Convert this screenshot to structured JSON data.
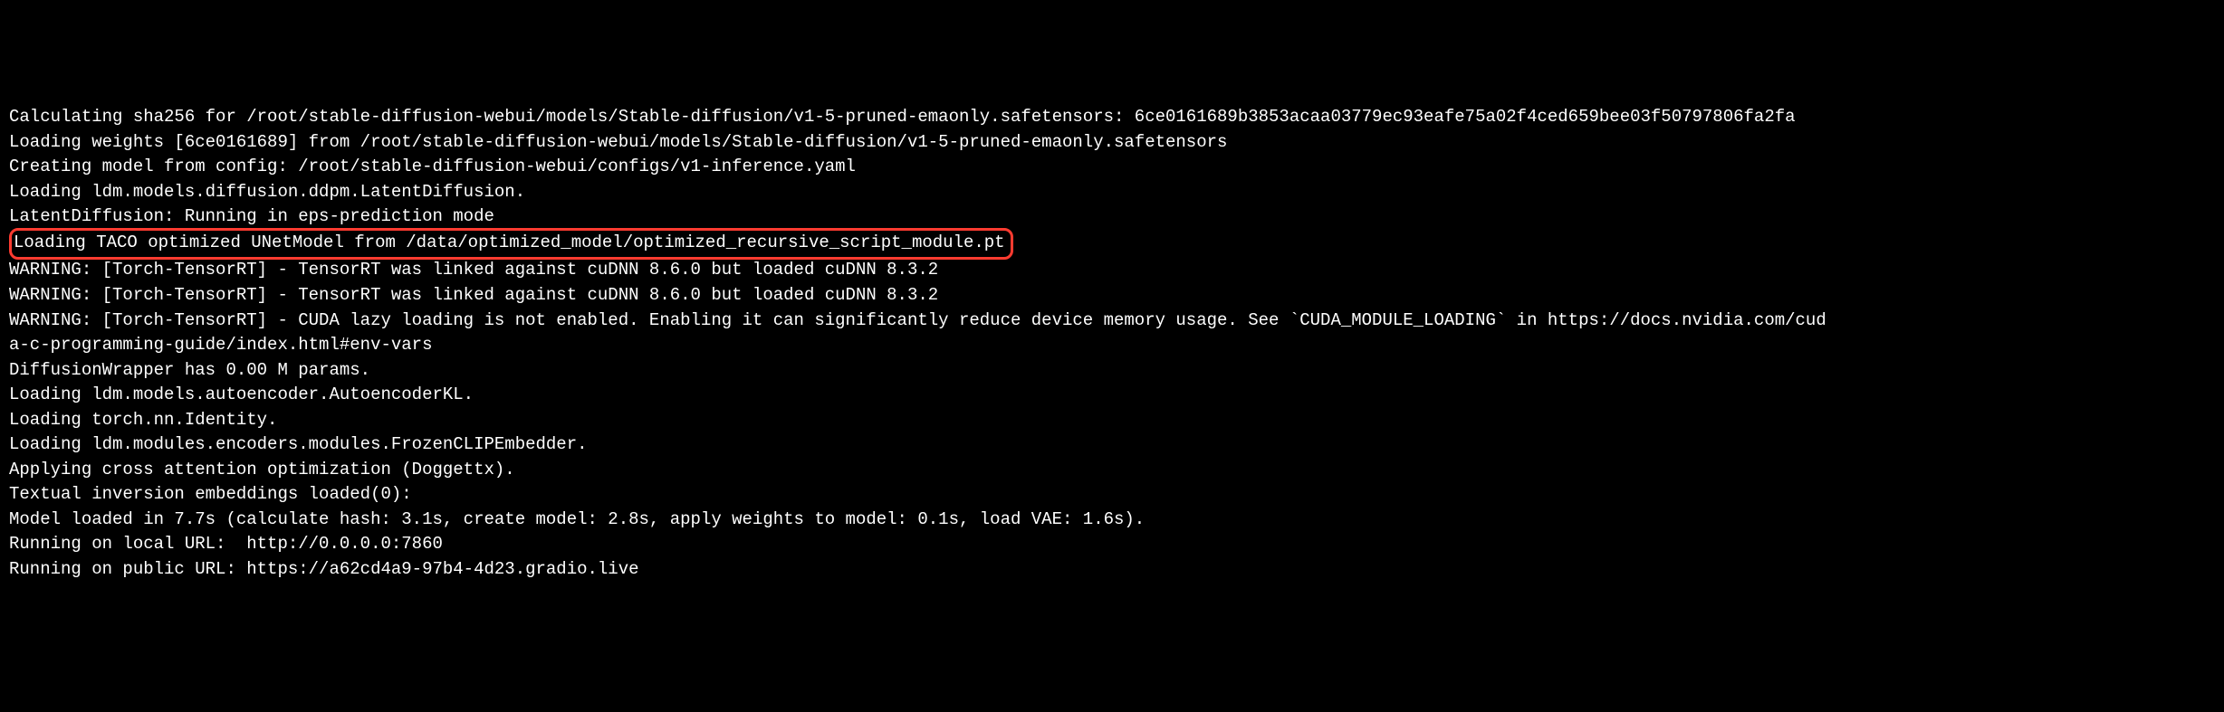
{
  "terminal": {
    "lines": [
      "Calculating sha256 for /root/stable-diffusion-webui/models/Stable-diffusion/v1-5-pruned-emaonly.safetensors: 6ce0161689b3853acaa03779ec93eafe75a02f4ced659bee03f50797806fa2fa",
      "Loading weights [6ce0161689] from /root/stable-diffusion-webui/models/Stable-diffusion/v1-5-pruned-emaonly.safetensors",
      "Creating model from config: /root/stable-diffusion-webui/configs/v1-inference.yaml",
      "Loading ldm.models.diffusion.ddpm.LatentDiffusion.",
      "LatentDiffusion: Running in eps-prediction mode",
      "Loading TACO optimized UNetModel from /data/optimized_model/optimized_recursive_script_module.pt",
      "WARNING: [Torch-TensorRT] - TensorRT was linked against cuDNN 8.6.0 but loaded cuDNN 8.3.2",
      "WARNING: [Torch-TensorRT] - TensorRT was linked against cuDNN 8.6.0 but loaded cuDNN 8.3.2",
      "WARNING: [Torch-TensorRT] - CUDA lazy loading is not enabled. Enabling it can significantly reduce device memory usage. See `CUDA_MODULE_LOADING` in https://docs.nvidia.com/cud",
      "a-c-programming-guide/index.html#env-vars",
      "DiffusionWrapper has 0.00 M params.",
      "Loading ldm.models.autoencoder.AutoencoderKL.",
      "Loading torch.nn.Identity.",
      "Loading ldm.modules.encoders.modules.FrozenCLIPEmbedder.",
      "Applying cross attention optimization (Doggettx).",
      "Textual inversion embeddings loaded(0):",
      "Model loaded in 7.7s (calculate hash: 3.1s, create model: 2.8s, apply weights to model: 0.1s, load VAE: 1.6s).",
      "Running on local URL:  http://0.0.0.0:7860",
      "Running on public URL: https://a62cd4a9-97b4-4d23.gradio.live"
    ],
    "highlighted_index": 5,
    "highlight_color": "#ff3b30"
  }
}
